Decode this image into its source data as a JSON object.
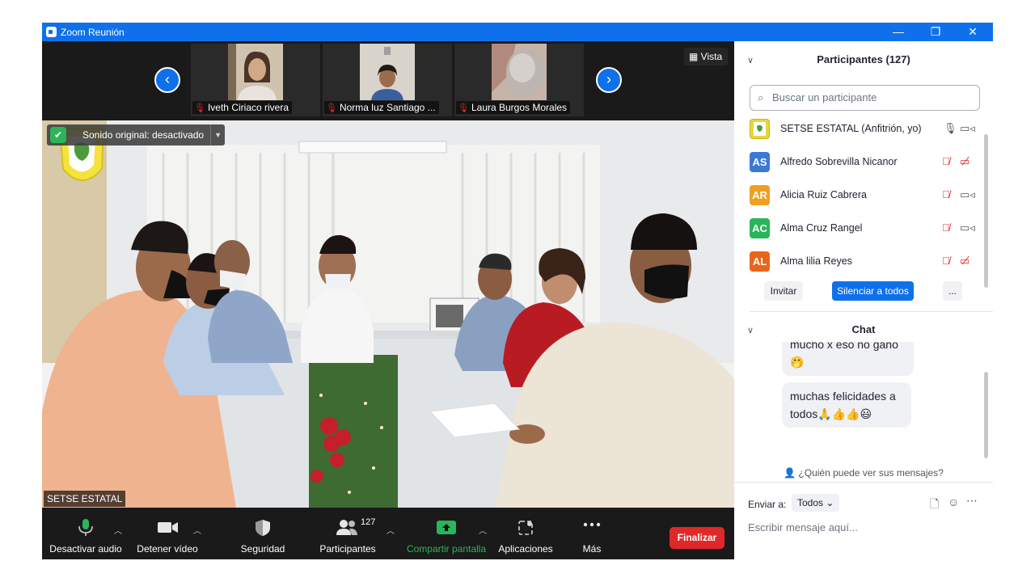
{
  "window": {
    "title": "Zoom Reunión",
    "minimize": "—",
    "restore": "❐",
    "close": "✕"
  },
  "thumbnails": {
    "prev": "‹",
    "next": "›",
    "items": [
      {
        "name": "Iveth Ciriaco rivera"
      },
      {
        "name": "Norma luz Santiago ..."
      },
      {
        "name": "Laura Burgos Morales"
      }
    ],
    "view_label": "Vista",
    "view_icon": "grid-icon"
  },
  "video": {
    "banner": "Sonido original: desactivado",
    "speaker": "SETSE ESTATAL"
  },
  "toolbar": {
    "audio": "Desactivar audio",
    "video": "Detener vídeo",
    "security": "Seguridad",
    "participants": "Participantes",
    "participants_count": "127",
    "share": "Compartir pantalla",
    "apps": "Aplicaciones",
    "more": "Más",
    "end": "Finalizar"
  },
  "participants_panel": {
    "title": "Participantes (127)",
    "search_placeholder": "Buscar un participante",
    "list": [
      {
        "initials": "",
        "name": "SETSE ESTATAL (Anfitrión, yo)",
        "color": "#e8d63a",
        "muted": false,
        "video_off": false
      },
      {
        "initials": "AS",
        "name": "Alfredo Sobrevilla Nicanor",
        "color": "#3a7ad5",
        "muted": true,
        "video_off": true
      },
      {
        "initials": "AR",
        "name": "Alicia Ruiz Cabrera",
        "color": "#f0a020",
        "muted": true,
        "video_off": false
      },
      {
        "initials": "AC",
        "name": "Alma Cruz Rangel",
        "color": "#2bb55a",
        "muted": true,
        "video_off": false
      },
      {
        "initials": "AL",
        "name": "Alma lilia Reyes",
        "color": "#e8651e",
        "muted": true,
        "video_off": true
      }
    ],
    "invite": "Invitar",
    "mute_all": "Silenciar a todos",
    "more": "..."
  },
  "chat": {
    "title": "Chat",
    "messages": [
      {
        "text": "mucho x eso no ganó 🤭"
      },
      {
        "text": "muchas felicidades a todos🙏👍👍😃"
      }
    ],
    "who_sees": "¿Quién puede ver sus mensajes?",
    "send_to_label": "Enviar a:",
    "send_to_value": "Todos",
    "input_placeholder": "Escribir mensaje aquí..."
  },
  "colors": {
    "zoom_blue": "#0e71eb",
    "end_red": "#e02828",
    "share_green": "#2bb55a",
    "mute_red": "#e02828"
  }
}
